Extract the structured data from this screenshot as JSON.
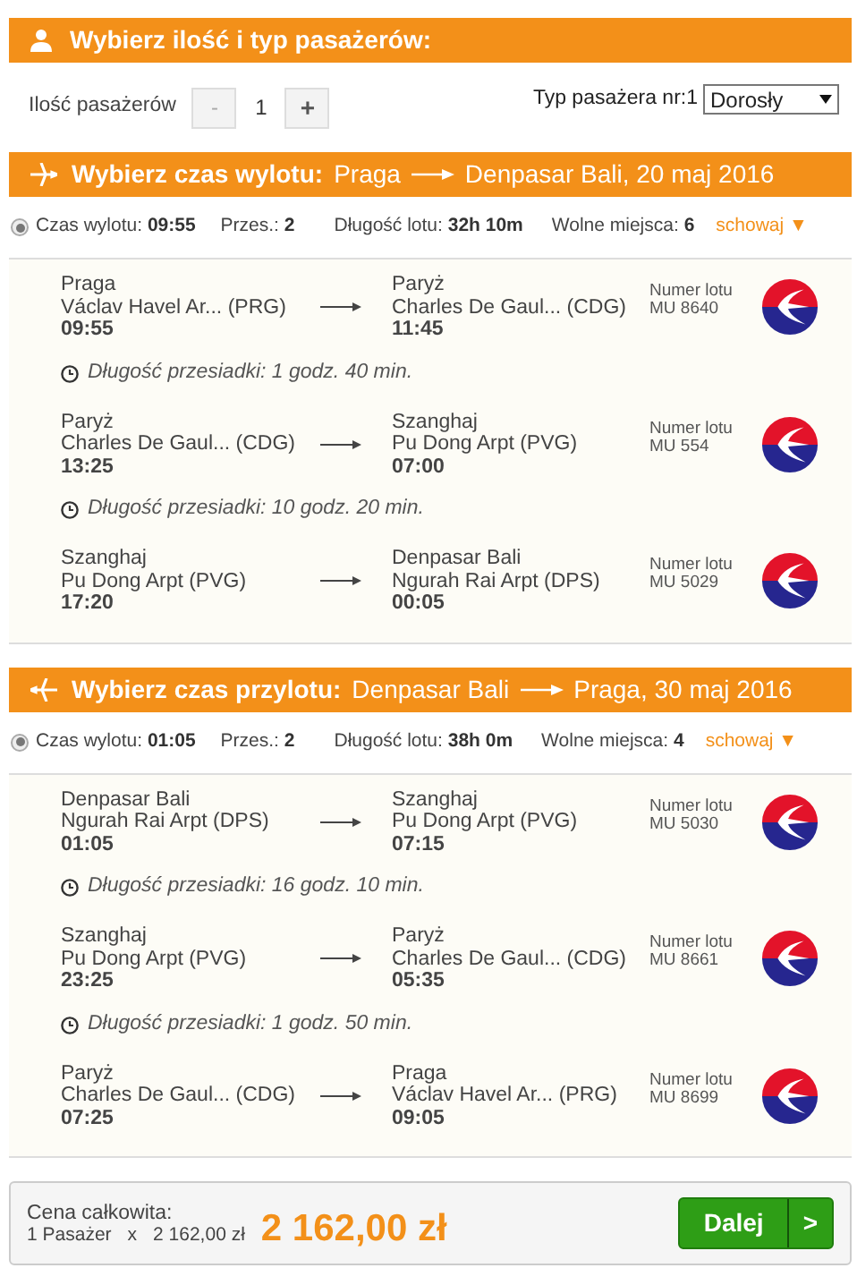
{
  "passengers": {
    "header": "Wybierz ilość i typ pasażerów:",
    "count_label": "Ilość pasażerów",
    "minus": "-",
    "count": "1",
    "plus": "+",
    "type_label": "Typ pasażera nr:1",
    "type_value": "Dorosły"
  },
  "journeys": [
    {
      "kind": "outbound",
      "header_label": "Wybierz czas wylotu:",
      "from": "Praga",
      "to": "Denpasar Bali, 20 maj 2016",
      "option": {
        "selected": true,
        "departure_label": "Czas wylotu:",
        "departure": "09:55",
        "stops_label": "Przes.:",
        "stops": "2",
        "duration_label": "Długość lotu:",
        "duration": "32h 10m",
        "seats_label": "Wolne miejsca:",
        "seats": "6",
        "toggle": "schowaj ▼"
      },
      "segments": [
        {
          "kind": "leg",
          "from_city": "Praga",
          "from_airport": "Václav Havel Ar... (PRG)",
          "from_time": "09:55",
          "to_city": "Paryż",
          "to_airport": "Charles De Gaul... (CDG)",
          "to_time": "11:45",
          "flight_label": "Numer lotu",
          "flight": "MU 8640"
        },
        {
          "kind": "transfer",
          "text": "Długość przesiadki: 1 godz. 40 min."
        },
        {
          "kind": "leg",
          "from_city": "Paryż",
          "from_airport": "Charles De Gaul... (CDG)",
          "from_time": "13:25",
          "to_city": "Szanghaj",
          "to_airport": "Pu Dong Arpt (PVG)",
          "to_time": "07:00",
          "flight_label": "Numer lotu",
          "flight": "MU 554"
        },
        {
          "kind": "transfer",
          "text": "Długość przesiadki: 10 godz. 20 min."
        },
        {
          "kind": "leg",
          "from_city": "Szanghaj",
          "from_airport": "Pu Dong Arpt (PVG)",
          "from_time": "17:20",
          "to_city": "Denpasar Bali",
          "to_airport": "Ngurah Rai Arpt (DPS)",
          "to_time": "00:05",
          "flight_label": "Numer lotu",
          "flight": "MU 5029"
        }
      ]
    },
    {
      "kind": "return",
      "header_label": "Wybierz czas przylotu:",
      "from": "Denpasar Bali",
      "to": "Praga, 30 maj 2016",
      "option": {
        "selected": true,
        "departure_label": "Czas wylotu:",
        "departure": "01:05",
        "stops_label": "Przes.:",
        "stops": "2",
        "duration_label": "Długość lotu:",
        "duration": "38h 0m",
        "seats_label": "Wolne miejsca:",
        "seats": "4",
        "toggle": "schowaj ▼"
      },
      "segments": [
        {
          "kind": "leg",
          "from_city": "Denpasar Bali",
          "from_airport": "Ngurah Rai Arpt (DPS)",
          "from_time": "01:05",
          "to_city": "Szanghaj",
          "to_airport": "Pu Dong Arpt (PVG)",
          "to_time": "07:15",
          "flight_label": "Numer lotu",
          "flight": "MU 5030"
        },
        {
          "kind": "transfer",
          "text": "Długość przesiadki: 16 godz. 10 min."
        },
        {
          "kind": "leg",
          "from_city": "Szanghaj",
          "from_airport": "Pu Dong Arpt (PVG)",
          "from_time": "23:25",
          "to_city": "Paryż",
          "to_airport": "Charles De Gaul... (CDG)",
          "to_time": "05:35",
          "flight_label": "Numer lotu",
          "flight": "MU 8661"
        },
        {
          "kind": "transfer",
          "text": "Długość przesiadki: 1 godz. 50 min."
        },
        {
          "kind": "leg",
          "from_city": "Paryż",
          "from_airport": "Charles De Gaul... (CDG)",
          "from_time": "07:25",
          "to_city": "Praga",
          "to_airport": "Václav Havel Ar... (PRG)",
          "to_time": "09:05",
          "flight_label": "Numer lotu",
          "flight": "MU 8699"
        }
      ]
    }
  ],
  "summary": {
    "label": "Cena całkowita:",
    "passengers": "1 Pasażer",
    "times": "x",
    "unit_price": "2 162,00 zł",
    "total": "2 162,00 zł",
    "next_button": "Dalej",
    "next_arrow": ">"
  }
}
